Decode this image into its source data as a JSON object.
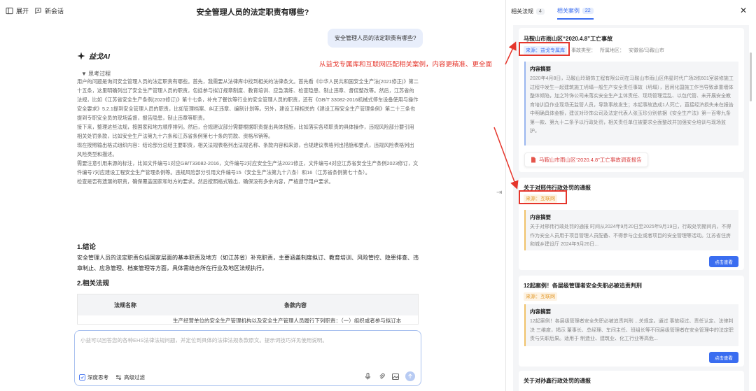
{
  "topbar": {
    "expand_label": "展开",
    "new_chat_label": "新会话",
    "title": "安全管理人员的法定职责有哪些?"
  },
  "chat": {
    "user_question": "安全管理人员的法定职责有哪些?",
    "ai_name": "益戈AI",
    "thinking_label": "▼ 思考过程",
    "thinking_paragraphs": [
      "用户的问题是询问安全管理人员的法定职责有哪些。首先，我需要从法律库中找到相关的法律条文。首先看《中华人民共和国安全生产法(2021修正)》第二十五条，这里明确列出了安全生产管理人员的职责，包括参与拟订规章制度、教育培训、应急演练、检查隐患、制止违章、督促整改等。然后，江苏省的法规，比如《江苏省安全生产条例(2023修订)》第十七条，补充了餐饮等行业的安全管理人员的职责，还有《GB/T 33082-2016机械式停车设备使用与操作安全要求》5.2.1提到安全管理人员的职责，比如管理档案、纠正违章、编制计划等。另外，建设工程相关的《建设工程安全生产管理条例》第二十三条也提到专职安全员的现场监督，报告隐患，制止违章等职责。",
      "接下来，整理这些法规，按国家和地方顺序排列。然后，合规建议部分需要根据职责提出具体措施，比如落实各项职责的具体操作，违规风险部分要引用相关处罚条款，比如安全生产法第九十六条和江苏省条例第七十条的罚款、资格吊销等。",
      "现在按照输出格式组织内容：结论部分总结主要职责，相关法规表格列出法规名称、条款内容和来源，合规建议表格列出措施和要点，违规风险表格列出风险类型和描述。",
      "需要注意引用来源的标注，比如文件编号1对应GB/T33082-2016，文件编号2对应安全生产法2021修正，文件编号4对应江苏省安全生产条例2023修订，文件编号7对应建设工程安全生产管理条例等。违规风险部分引用文件编号15（安全生产法第九十六条）和16（江苏省条例第七十条）。",
      "检查是否有遗漏的职责，确保覆盖国家和地方的要求。然后按照格式输出，确保没有多余内容，严格遵守用户要求。"
    ],
    "annotation": "从益戈专属库和互联网匹配相关案例，内容更精准、更全面",
    "conclusion_heading": "1.结论",
    "conclusion_text": "安全管理人员的法定职责包括国家层面的基本职责及地方（如江苏省）补充职责，主要涵盖制度拟订、教育培训、风险管控、隐患排查、违章制止、应急管理、档案管理等方面，具体需结合所在行业及地区法规执行。",
    "laws_heading": "2.相关法规",
    "table": {
      "col1": "法规名称",
      "col2": "条款内容",
      "row1_col2": "生产经营单位的安全生产管理机构以及安全生产管理人员履行下列职责：（一）组织或者参与拟订本"
    },
    "input": {
      "placeholder": "小益可以回答您的各种EHS法律法规问题，并定位到具体的法律法规条款原文。提示词技巧详见使用说明。",
      "deep_think_label": "深度思考",
      "filter_label": "高级过滤"
    }
  },
  "panel": {
    "tabs": [
      {
        "label": "相关法规",
        "count": "4"
      },
      {
        "label": "相关案例",
        "count": "22"
      }
    ],
    "cards": [
      {
        "title": "马鞍山市雨山区“2020.4.8”工亡事故",
        "source": "来源：",
        "source_name": "益戈专属库",
        "type": "事故类型：",
        "region_label": "所属地区：",
        "region": "安徽省/马鞍山市",
        "summary_title": "内容摘要",
        "summary": "2020年4月8日，马鞍山玲璐饰工程有限公司在马鞍山市雨山区伟星时代广场2栋601室装修施工过程中发生一起建筑施工坍塌一般生产安全责任事故（坍塌），因闲化国施工作当导致承重墙体整体倾陷，加之玲饰公司未落实安全生产主体责任、现场管理混乱、以包代管、未开展安全教育培训且作业现场无监管人员，导致事故发生；本起事故造成1人死亡，直接经济损失未在报告中明确具体金额，建议对玲饰公司及法定代表人张玉珍分别依据《安全生产法》第一百零九条第一款、第九十二条予以行政处罚，相关责任单位被要求全面整改并加强安全培训与现场监护。",
        "doc_link": "马鞍山市雨山区“2020.4.8”工亡事故调查报告"
      },
      {
        "title": "关于对邢伟行政处罚的通报",
        "source": "来源：",
        "source_name": "互联网",
        "summary_title": "内容摘要",
        "summary": "关于对邢伟行政处罚的通报 时间从2024年9月20日至2025年9月19日，行政处罚期间内，不得作为安全人员用于项目管理人员配备、不得参与企业或者项目的安全管理等活动。江苏省住房和城乡建设厅 2024年9月26日...",
        "view_label": "点击查看"
      },
      {
        "title": "12起案例！各层级管理者安全失职必被追责判刑",
        "source": "来源：",
        "source_name": "互联网",
        "summary_title": "内容摘要",
        "summary": "12起案例！各层级管理者安全失职必被追责判刑 ...关规定。通过 事故经过、责任认定、法律判决 三维度，揭示 董事长、总经理、车间主任、班组长等不同层级管理者在安全管理中的法定职责与失职后果。适用于 制造业、建筑业、化工行业等高危...",
        "view_label": "点击查看"
      },
      {
        "title": "关于对孙鑫行政处罚的通报"
      }
    ]
  },
  "colors": {
    "accent": "#3a6df0",
    "annotation": "#e5352b",
    "source_org": "#e39a2b"
  },
  "icons": [
    "expand-icon",
    "new-chat-icon",
    "ai-logo-icon",
    "close-icon",
    "pdf-icon",
    "mic-icon",
    "attach-icon",
    "image-icon",
    "send-icon",
    "deep-think-icon",
    "filter-icon",
    "collapse-panel-icon"
  ]
}
